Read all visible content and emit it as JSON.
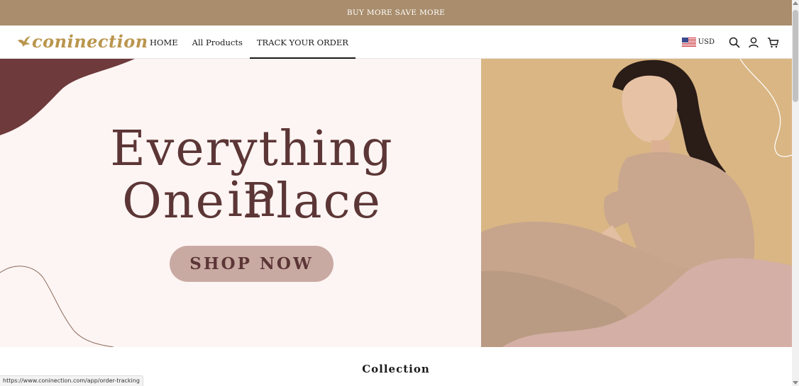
{
  "announcement": {
    "text": "BUY MORE SAVE MORE"
  },
  "header": {
    "logo_text": "coninection",
    "nav": [
      {
        "label": "HOME",
        "active": false
      },
      {
        "label": "All Products",
        "active": false
      },
      {
        "label": "TRACK YOUR ORDER",
        "active": true
      }
    ],
    "currency": {
      "label": "USD",
      "flag": "us-flag-icon"
    },
    "icons": [
      "search-icon",
      "account-icon",
      "cart-icon"
    ]
  },
  "hero": {
    "headline_line1": "Everything in",
    "headline_line2": "One Place",
    "cta_label": "SHOP NOW"
  },
  "sections": {
    "collection_title": "Collection"
  },
  "status_bar": {
    "url": "https://www.coninection.com/app/order-tracking"
  },
  "colors": {
    "announcement_bg": "#a98d6c",
    "logo": "#b9954d",
    "hero_bg": "#fdf5f3",
    "headline": "#5c3636",
    "cta_bg": "#c9aaa3",
    "photo_bg": "#d9b684"
  }
}
